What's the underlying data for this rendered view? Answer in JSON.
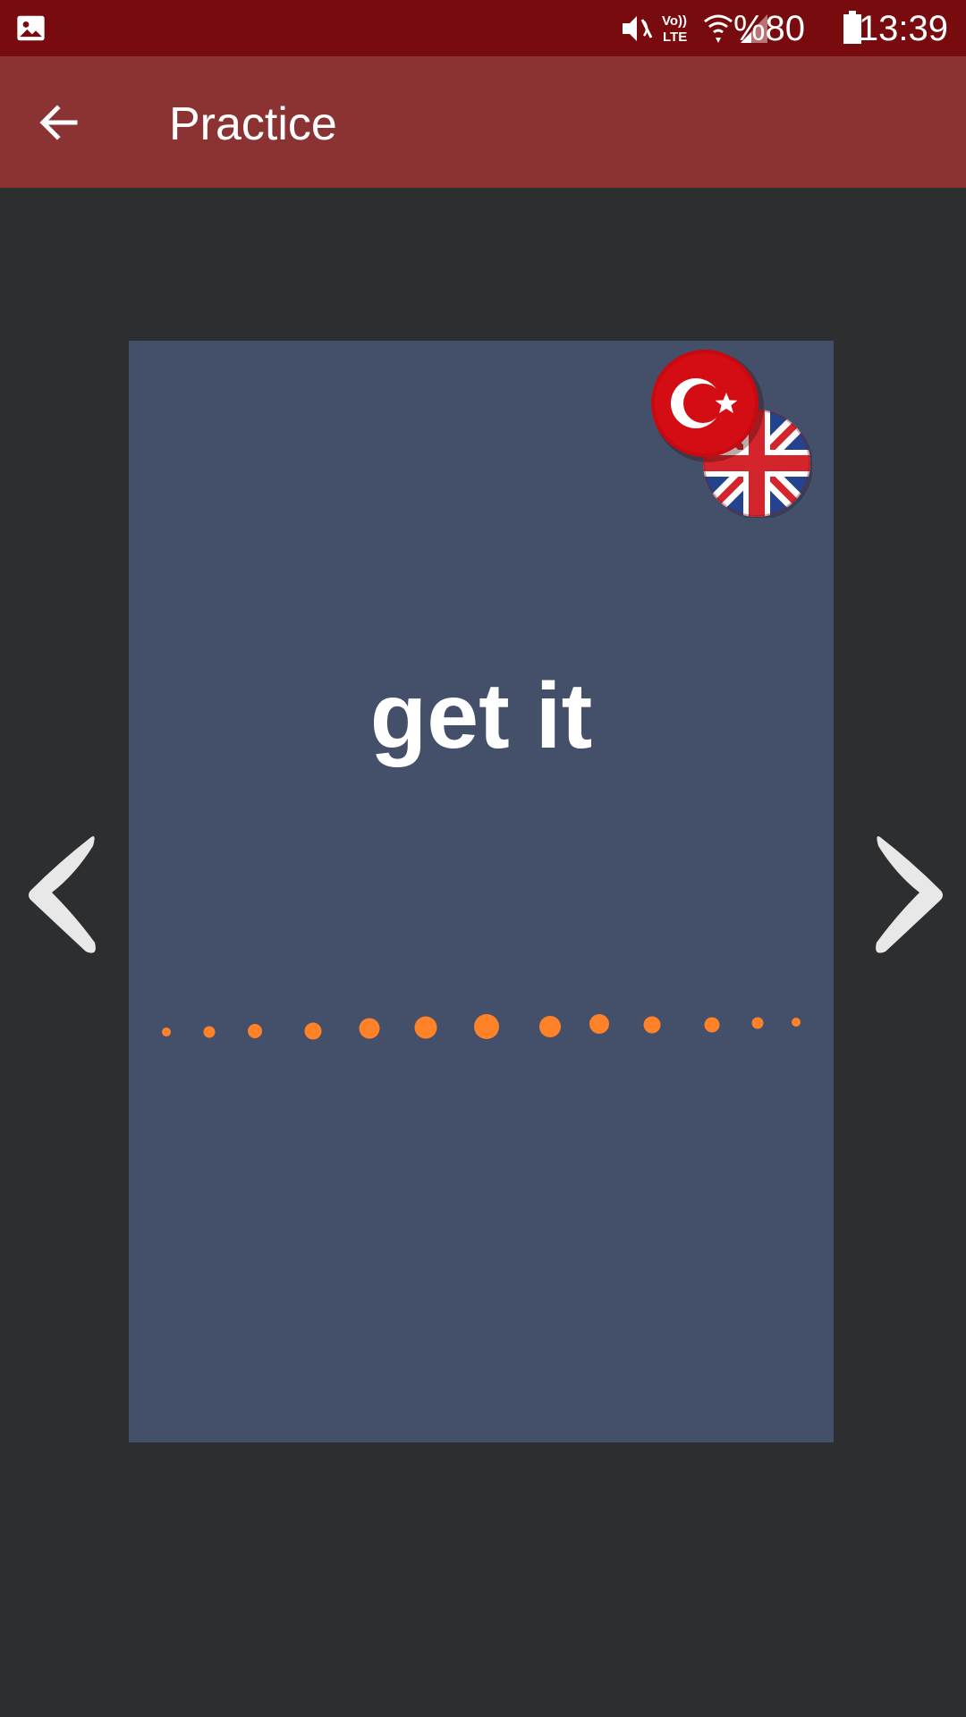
{
  "status_bar": {
    "battery_percent": "%80",
    "time": "13:39",
    "icons": [
      "gallery-icon",
      "vibrate-mute-icon",
      "volte-icon",
      "wifi-icon",
      "signal-icon",
      "battery-icon"
    ]
  },
  "app_bar": {
    "title": "Practice",
    "back_icon": "arrow-left-icon"
  },
  "card": {
    "word": "get it",
    "language_flags": [
      "turkey-flag-icon",
      "uk-flag-icon"
    ],
    "audio_visualizer_color": "#ff8128"
  },
  "navigation": {
    "prev_icon": "chevron-left-icon",
    "next_icon": "chevron-right-icon"
  },
  "colors": {
    "status_bar": "#770b0d",
    "app_bar": "#8b3233",
    "background": "#2d2e30",
    "card": "#44506a",
    "accent": "#ff8128"
  }
}
